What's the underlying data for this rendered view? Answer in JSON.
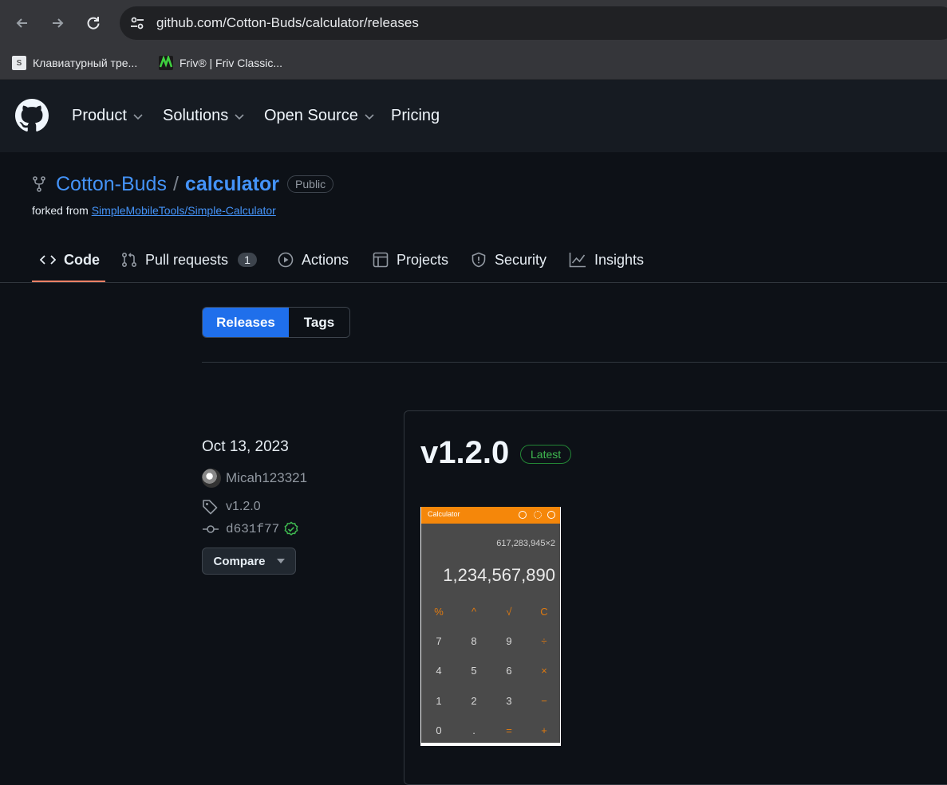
{
  "browser": {
    "url": "github.com/Cotton-Buds/calculator/releases",
    "bookmarks": [
      {
        "label": "Клавиатурный тре...",
        "favicon": "S"
      },
      {
        "label": "Friv® | Friv Classic...",
        "favicon": "friv-icon"
      }
    ]
  },
  "header": {
    "menu": [
      "Product",
      "Solutions",
      "Open Source",
      "Pricing"
    ]
  },
  "repo": {
    "owner": "Cotton-Buds",
    "name": "calculator",
    "visibility": "Public",
    "forked_prefix": "forked from",
    "forked_from": "SimpleMobileTools/Simple-Calculator"
  },
  "tabs": [
    {
      "label": "Code",
      "icon": "code-icon"
    },
    {
      "label": "Pull requests",
      "icon": "git-pull-request-icon",
      "count": "1"
    },
    {
      "label": "Actions",
      "icon": "play-icon"
    },
    {
      "label": "Projects",
      "icon": "table-icon"
    },
    {
      "label": "Security",
      "icon": "shield-icon"
    },
    {
      "label": "Insights",
      "icon": "graph-icon"
    }
  ],
  "releases_nav": {
    "releases": "Releases",
    "tags": "Tags"
  },
  "release": {
    "date": "Oct 13, 2023",
    "author": "Micah123321",
    "tag": "v1.2.0",
    "commit": "d631f77",
    "compare": "Compare",
    "title": "v1.2.0",
    "badge": "Latest",
    "screenshot": {
      "app_title": "Calculator",
      "formula": "617,283,945×2",
      "result": "1,234,567,890",
      "keys": [
        [
          "%",
          "^",
          "√",
          "C"
        ],
        [
          "7",
          "8",
          "9",
          "÷"
        ],
        [
          "4",
          "5",
          "6",
          "×"
        ],
        [
          "1",
          "2",
          "3",
          "−"
        ],
        [
          "0",
          ".",
          "=",
          "+"
        ]
      ]
    }
  },
  "colors": {
    "accent": "#1f6feb",
    "link": "#4493f8",
    "latest": "#3fb950",
    "tab_underline": "#f78166",
    "calc_orange": "#f5870a"
  }
}
